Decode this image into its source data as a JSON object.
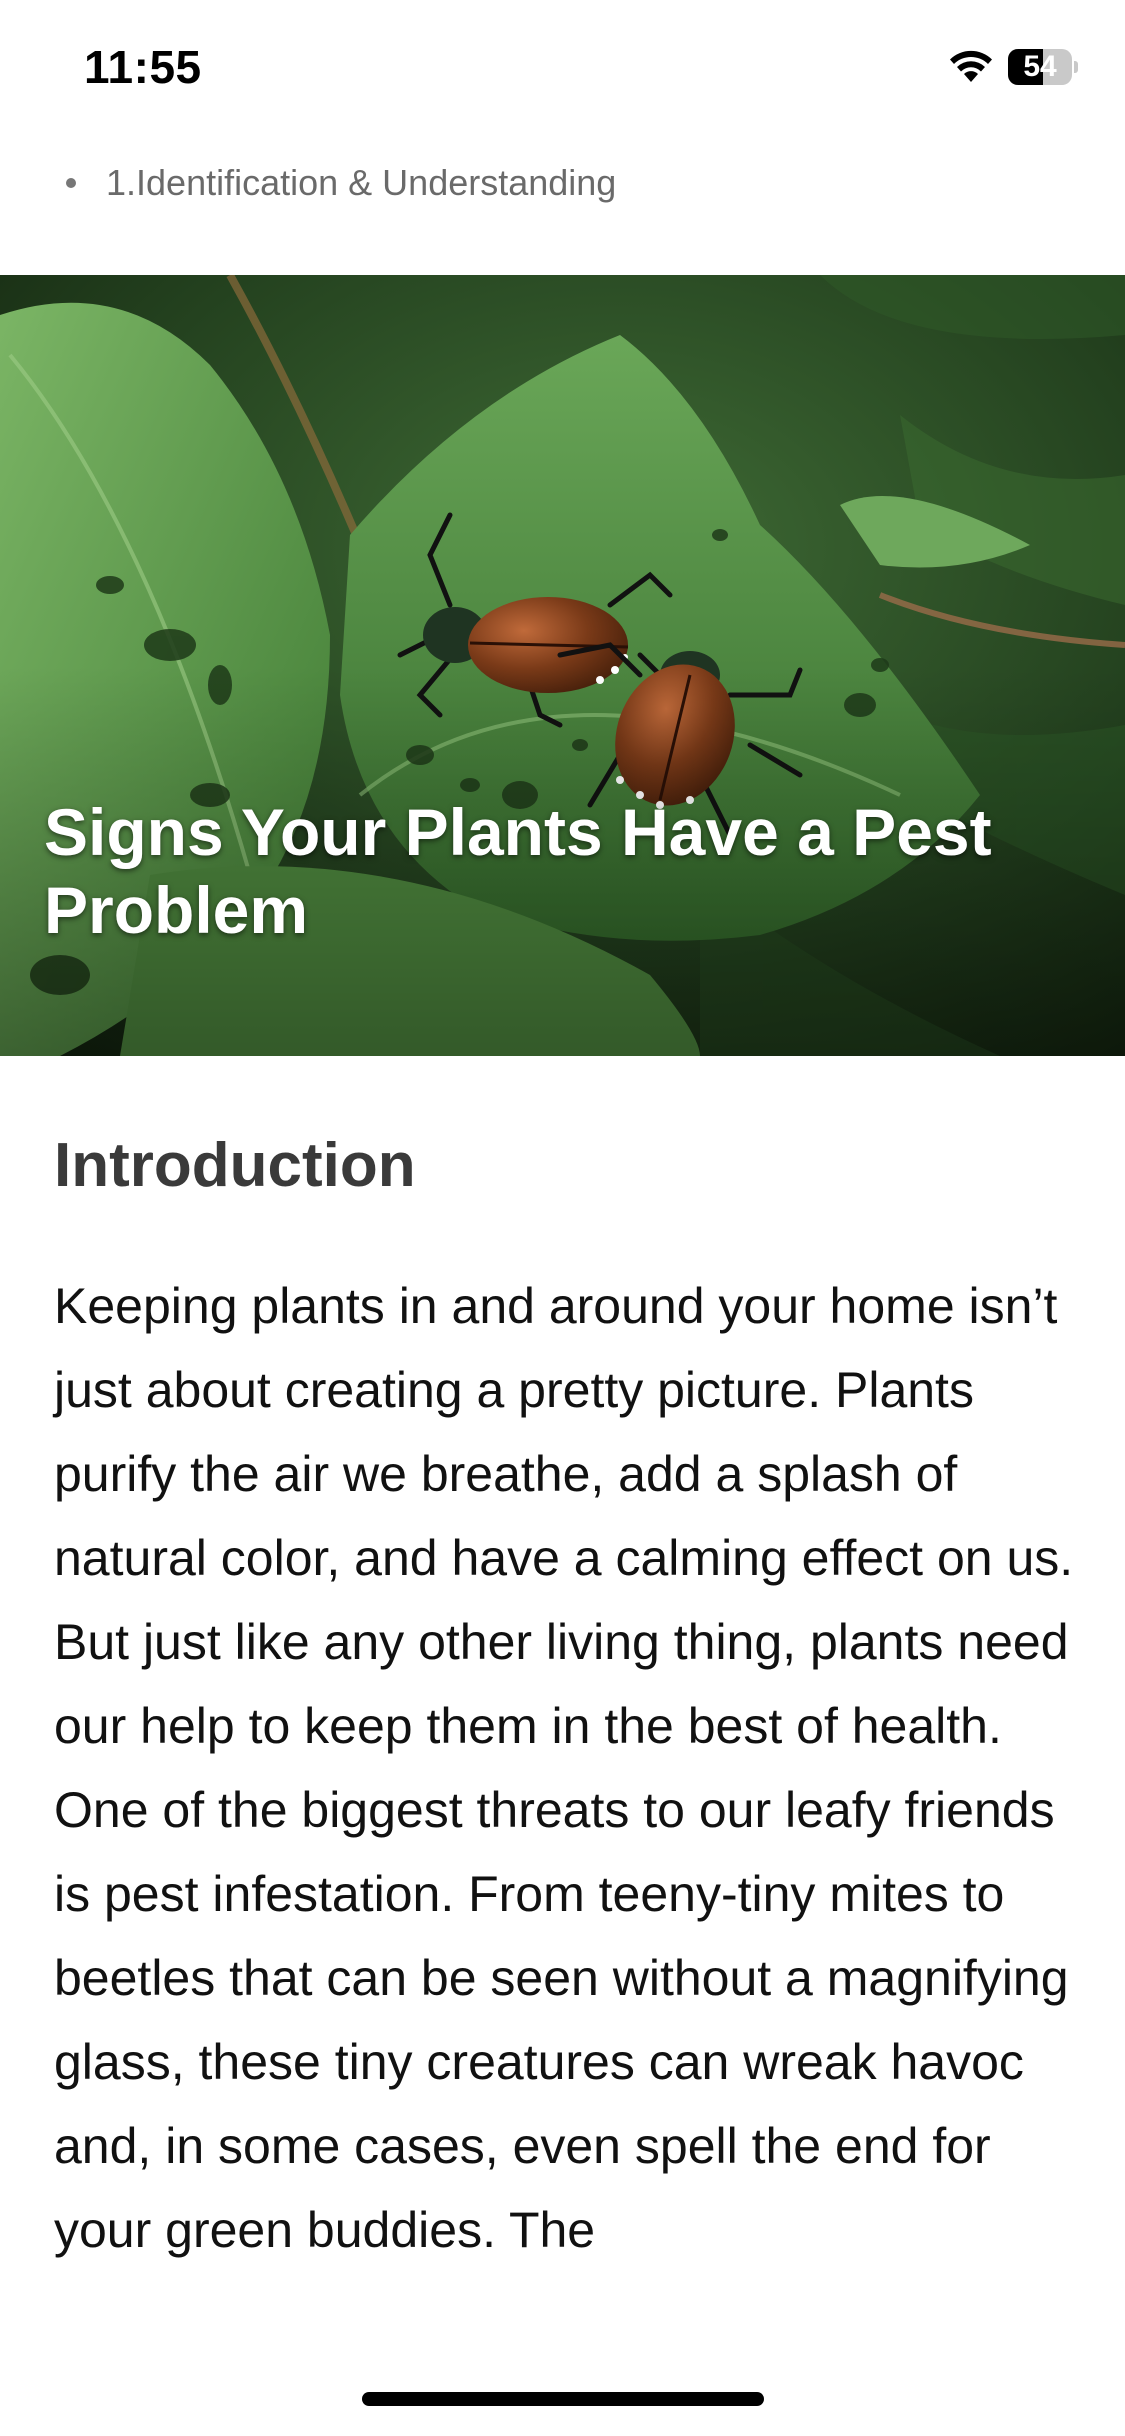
{
  "status_bar": {
    "time": "11:55",
    "battery_level": "54",
    "wifi_icon": "wifi-icon",
    "battery_icon": "battery-icon"
  },
  "breadcrumb": {
    "label": "1.Identification & Understanding"
  },
  "hero": {
    "image_subject": "beetles on leaf",
    "title": "Signs Your Plants Have a Pest Problem"
  },
  "article": {
    "heading": "Introduction",
    "body": "Keeping plants in and around your home isn’t just about creating a pretty picture. Plants purify the air we breathe, add a splash of natural color, and have a calming effect on us. But just like any other living thing, plants need our help to keep them in the best of health. One of the biggest threats to our leafy friends is pest infestation. From teeny-tiny mites to beetles that can be seen without a magnifying glass, these tiny creatures can wreak havoc and, in some cases, even spell the end for your green buddies. The"
  },
  "colors": {
    "heading": "#3a3a3a",
    "breadcrumb": "#6a6a6a",
    "leaf": "#5c9a4a",
    "beetle_shell": "#7a3a18"
  }
}
